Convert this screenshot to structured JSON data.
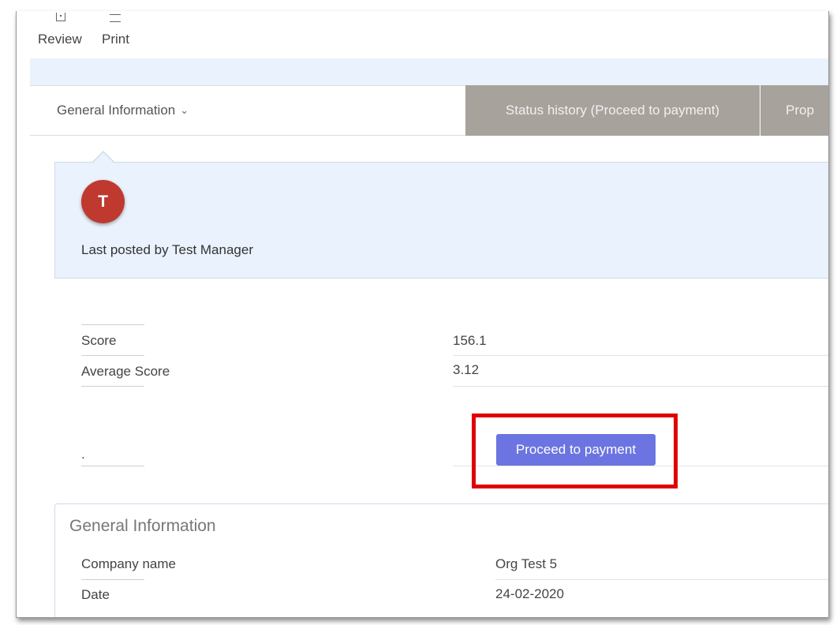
{
  "toolbar": {
    "review_label": "Review",
    "print_label": "Print"
  },
  "tabs": [
    {
      "label": "General Information",
      "active": true
    },
    {
      "label": "Status history (Proceed to payment)"
    },
    {
      "label": "Prop"
    }
  ],
  "post": {
    "avatar_letter": "T",
    "avatar_color": "#c0392f",
    "text": "Last posted by Test Manager"
  },
  "scores": {
    "score_label": "Score",
    "score_value": "156.1",
    "average_label": "Average Score",
    "average_value": "3.12"
  },
  "action": {
    "dot_label": ".",
    "button_label": "Proceed to payment",
    "button_color": "#6b74e0",
    "highlight_color": "#e00000"
  },
  "general_info": {
    "title": "General Information",
    "company_label": "Company name",
    "company_value": "Org Test 5",
    "date_label": "Date",
    "date_value": "24-02-2020"
  }
}
